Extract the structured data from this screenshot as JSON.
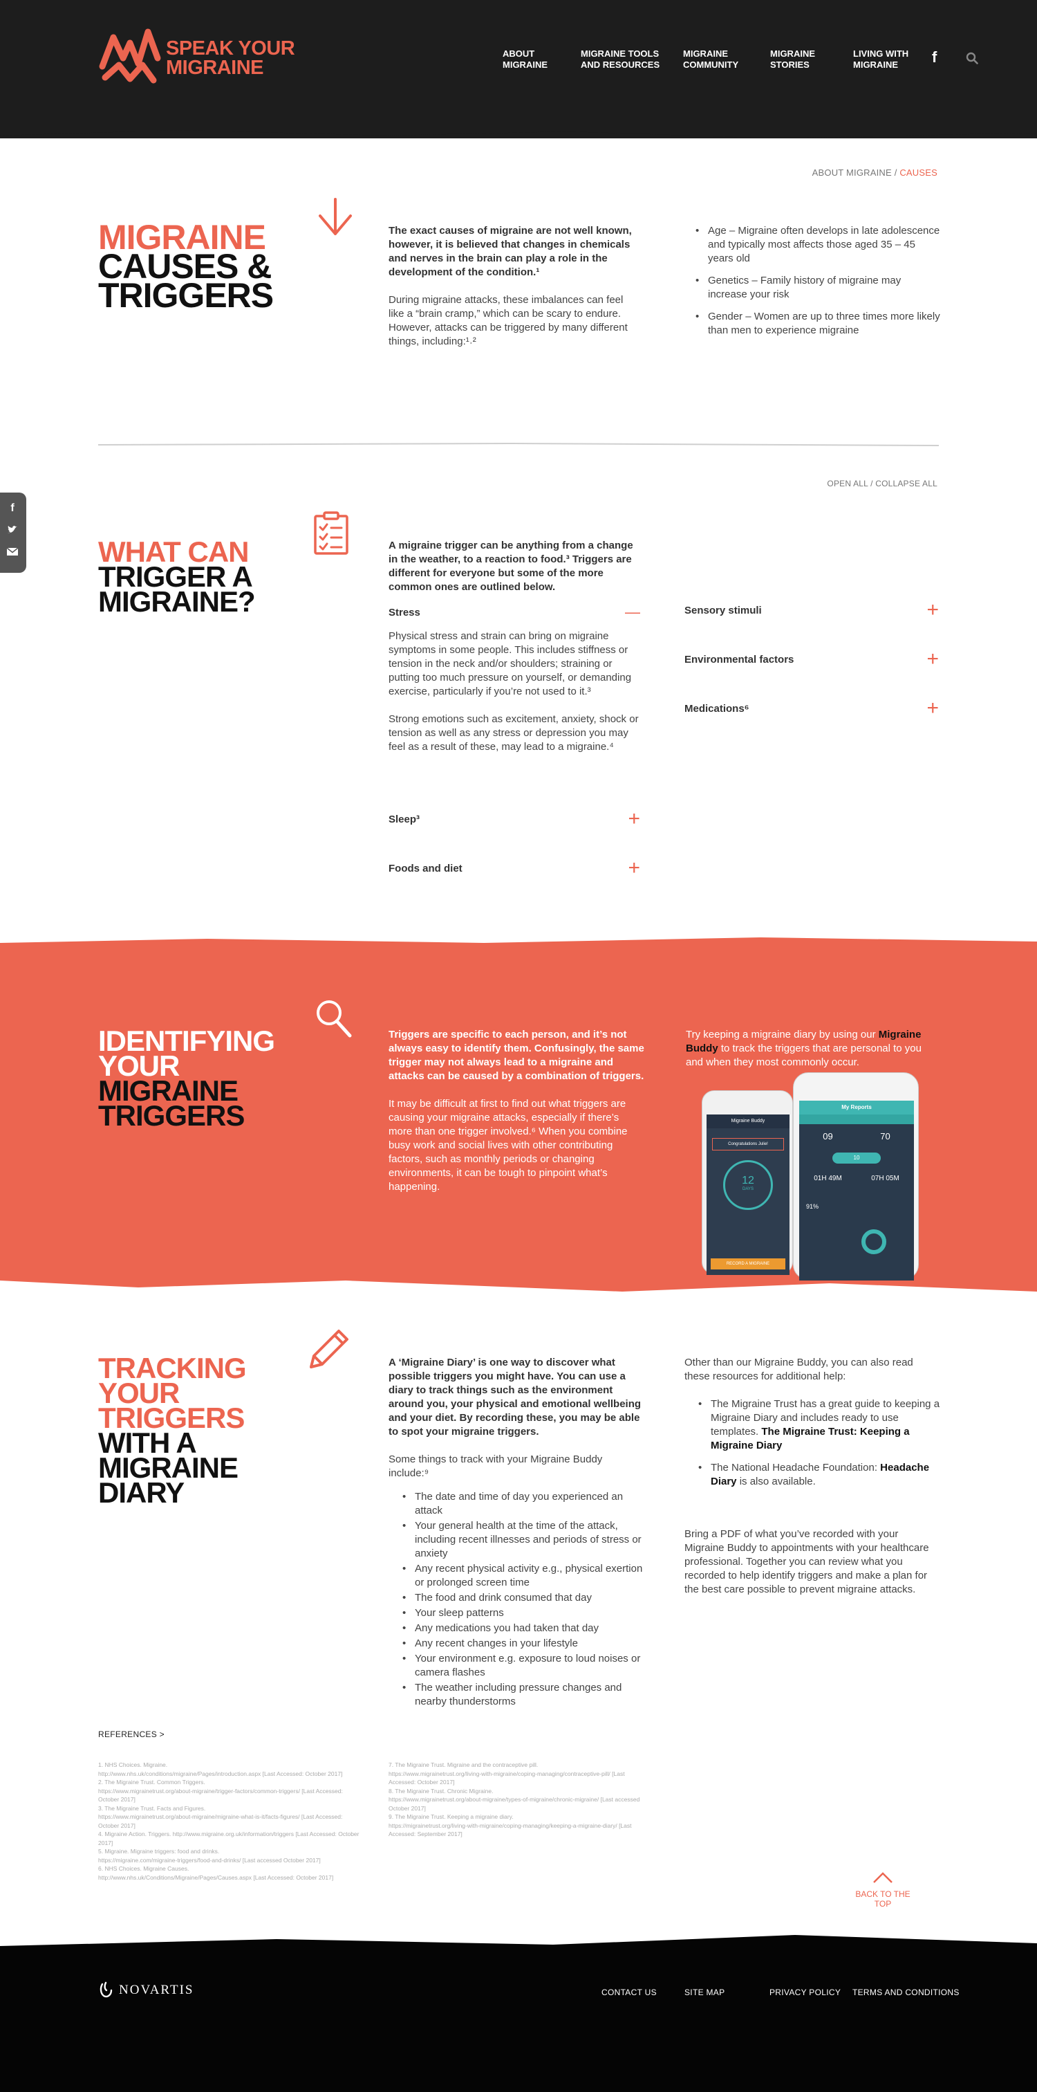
{
  "header": {
    "logo_line1": "SPEAK YOUR",
    "logo_line2": "MIGRAINE",
    "nav": [
      {
        "line1": "ABOUT",
        "line2": "MIGRAINE"
      },
      {
        "line1": "MIGRAINE TOOLS",
        "line2": "AND RESOURCES"
      },
      {
        "line1": "MIGRAINE",
        "line2": "COMMUNITY"
      },
      {
        "line1": "MIGRAINE",
        "line2": "STORIES"
      },
      {
        "line1": "LIVING WITH",
        "line2": "MIGRAINE"
      }
    ],
    "facebook_glyph": "f",
    "search_icon": "search-icon"
  },
  "breadcrumb": {
    "parent": "ABOUT MIGRAINE",
    "sep": " / ",
    "current": "CAUSES"
  },
  "causes": {
    "title_orange": "MIGRAINE",
    "title_black1": "CAUSES &",
    "title_black2": "TRIGGERS",
    "intro_bold": "The exact causes of migraine are not well known, however, it is believed that changes in chemicals and nerves in the brain can play a role in the development of the condition.¹",
    "intro_text": "During migraine attacks, these imbalances can feel like a “brain cramp,” which can be scary to endure. However, attacks can be triggered by many different things, including:¹˒²",
    "bullets": [
      "Age – Migraine often develops in late adolescence and typically most affects those aged 35 – 45 years old",
      "Genetics – Family history of migraine may increase your risk",
      "Gender – Women are up to three times more likely than men to experience migraine"
    ]
  },
  "open_all": "OPEN ALL / COLLAPSE ALL",
  "triggers": {
    "title_orange": "WHAT CAN",
    "title_black1": "TRIGGER A",
    "title_black2": "MIGRAINE?",
    "intro_bold": "A migraine trigger can be anything from a change in the weather, to a reaction to food.³ Triggers are different for everyone but some of the more common ones are outlined below.",
    "stress_label": "Stress",
    "stress_sign": "—",
    "stress_p1": "Physical stress and strain can bring on migraine symptoms in some people. This includes stiffness or tension in the neck and/or shoulders; straining or putting too much pressure on yourself, or demanding exercise, particularly if you’re not used to it.³",
    "stress_p2": "Strong emotions such as excitement, anxiety, shock or tension as well as any stress or depression you may feel as a result of these, may lead to a migraine.⁴",
    "left_items": [
      "Sleep³",
      "Foods and diet"
    ],
    "right_items": [
      "Sensory stimuli",
      "Environmental factors",
      "Medications⁶"
    ],
    "plus_sign": "+"
  },
  "identify": {
    "title_white1": "IDENTIFYING",
    "title_white2": "YOUR",
    "title_black1": "MIGRAINE",
    "title_black2": "TRIGGERS",
    "intro_bold": "Triggers are specific to each person, and it’s not always easy to identify them. Confusingly, the same trigger may not always lead to a migraine and attacks can be caused by a combination of triggers.",
    "text": "It may be difficult at first to find out what triggers are causing your migraine attacks, especially if there’s more than one trigger involved.⁶ When you combine busy work and social lives with other contributing factors, such as monthly periods or changing environments, it can be tough to pinpoint what’s happening.",
    "diary_pre": "Try keeping a migraine diary by using our ",
    "diary_link": "Migraine Buddy",
    "diary_post": " to track the triggers that are personal to you and when they most commonly occur.",
    "phone_back": {
      "title": "Migraine Buddy",
      "congrats": "Congratulations Julie!",
      "days": "12",
      "days_label": "DAYS",
      "footer": "RECORD A MIGRAINE"
    },
    "phone_front": {
      "title": "My Reports",
      "stat1": "09",
      "stat2": "70",
      "time1": "01H 49M",
      "time2": "07H 05M",
      "pill": "10",
      "pct": "91%"
    }
  },
  "tracking": {
    "title_orange1": "TRACKING",
    "title_orange2": "YOUR",
    "title_orange3": "TRIGGERS",
    "title_black1": "WITH A",
    "title_black2": "MIGRAINE",
    "title_black3": "DIARY",
    "intro_bold": "A ‘Migraine Diary’ is one way to discover what possible triggers you might have. You can use a diary to track things such as the environment around you, your physical and emotional wellbeing and your diet. By recording these, you may be able to spot your migraine triggers.",
    "list_intro": "Some things to track with your Migraine Buddy include:⁹",
    "list": [
      "The date and time of day you experienced an attack",
      "Your general health at the time of the attack, including recent illnesses and periods of stress or anxiety",
      "Any recent physical activity e.g., physical exertion or prolonged screen time",
      "The food and drink consumed that day",
      "Your sleep patterns",
      "Any medications you had taken that day",
      "Any recent changes in your lifestyle",
      "Your environment e.g. exposure to loud noises or camera flashes",
      "The weather including pressure changes and nearby thunderstorms"
    ],
    "right_intro": "Other than our Migraine Buddy, you can also read these resources for additional help:",
    "res1_pre": "The Migraine Trust has a great guide to keeping a Migraine Diary and includes ready to use templates. ",
    "res1_link": "The Migraine Trust: Keeping a Migraine Diary",
    "res2_pre": "The National Headache Foundation: ",
    "res2_link": "Headache Diary",
    "res2_post": " is also available.",
    "pdf_text": "Bring a PDF of what you’ve recorded with your Migraine Buddy to appointments with your healthcare professional. Together you can review what you recorded to help identify triggers and make a plan for the best care possible to prevent migraine attacks."
  },
  "references": {
    "title": "REFERENCES >",
    "col1": [
      "1. NHS Choices. Migraine.",
      "http://www.nhs.uk/conditions/migraine/Pages/introduction.aspx [Last Accessed: October 2017]",
      "2. The Migraine Trust. Common Triggers.",
      "https://www.migrainetrust.org/about-migraine/trigger-factors/common-triggers/ [Last Accessed: October 2017]",
      "3. The Migraine Trust. Facts and Figures.",
      "https://www.migrainetrust.org/about-migraine/migraine-what-is-it/facts-figures/ [Last Accessed: October 2017]",
      "4. Migraine Action. Triggers. http://www.migraine.org.uk/information/triggers [Last Accessed: October 2017]",
      "5. Migraine. Migraine triggers: food and drinks.",
      "https://migraine.com/migraine-triggers/food-and-drinks/ [Last accessed October 2017]",
      "6. NHS Choices. Migraine Causes.",
      "http://www.nhs.uk/Conditions/Migraine/Pages/Causes.aspx [Last Accessed: October 2017]"
    ],
    "col2": [
      "7. The Migraine Trust. Migraine and the contraceptive pill.",
      "https://www.migrainetrust.org/living-with-migraine/coping-managing/contraceptive-pill/ [Last Accessed: October 2017]",
      "8. The Migraine Trust. Chronic Migraine.",
      "https://www.migrainetrust.org/about-migraine/types-of-migraine/chronic-migraine/ [Last accessed October 2017]",
      "9. The Migraine Trust. Keeping a migraine diary.",
      "https://migrainetrust.org/living-with-migraine/coping-managing/keeping-a-migraine-diary/ [Last Accessed: September 2017]"
    ]
  },
  "back_to_top": "BACK TO THE TOP",
  "footer": {
    "brand": "NOVARTIS",
    "links": [
      "CONTACT US",
      "SITE MAP",
      "PRIVACY POLICY",
      "TERMS AND CONDITIONS"
    ]
  },
  "colors": {
    "accent": "#ec6550",
    "dark": "#1d1d1d",
    "footer": "#050505"
  }
}
